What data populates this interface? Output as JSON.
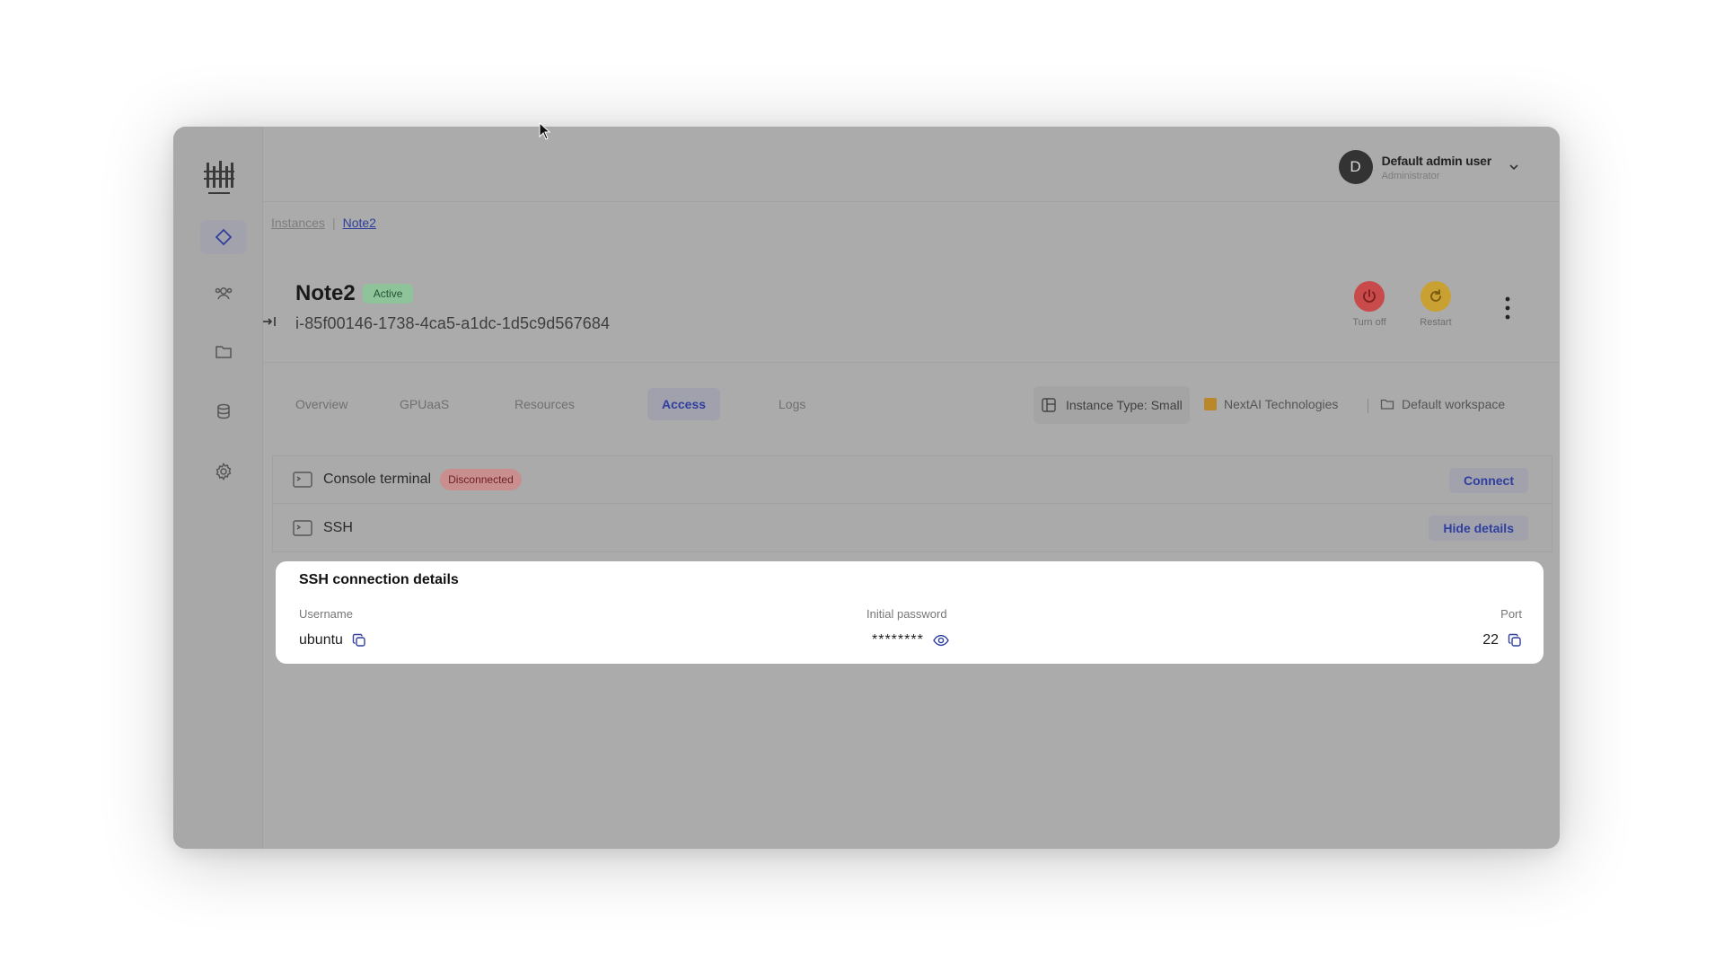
{
  "user": {
    "initial": "D",
    "name": "Default admin user",
    "role": "Administrator"
  },
  "breadcrumb": {
    "parent": "Instances",
    "separator": "|",
    "current": "Note2"
  },
  "instance": {
    "name": "Note2",
    "status": "Active",
    "id": "i-85f00146-1738-4ca5-a1dc-1d5c9d567684"
  },
  "actions": {
    "turn_off": "Turn off",
    "restart": "Restart"
  },
  "tabs": [
    "Overview",
    "GPUaaS",
    "Resources",
    "Access",
    "Logs"
  ],
  "active_tab": "Access",
  "meta": {
    "instance_type": "Instance Type: Small",
    "organization": "NextAI Technologies",
    "workspace": "Default workspace"
  },
  "console": {
    "label": "Console terminal",
    "status": "Disconnected",
    "button": "Connect"
  },
  "ssh": {
    "label": "SSH",
    "button": "Hide details"
  },
  "ssh_details": {
    "title": "SSH connection details",
    "username_label": "Username",
    "username": "ubuntu",
    "password_label": "Initial password",
    "password": "********",
    "port_label": "Port",
    "port": "22"
  },
  "colors": {
    "accent": "#2f3f9e",
    "active_badge": "#8fc49a",
    "disconnected_badge": "#c98f8f",
    "turn_off": "#c94a4a",
    "restart": "#c9a032"
  }
}
